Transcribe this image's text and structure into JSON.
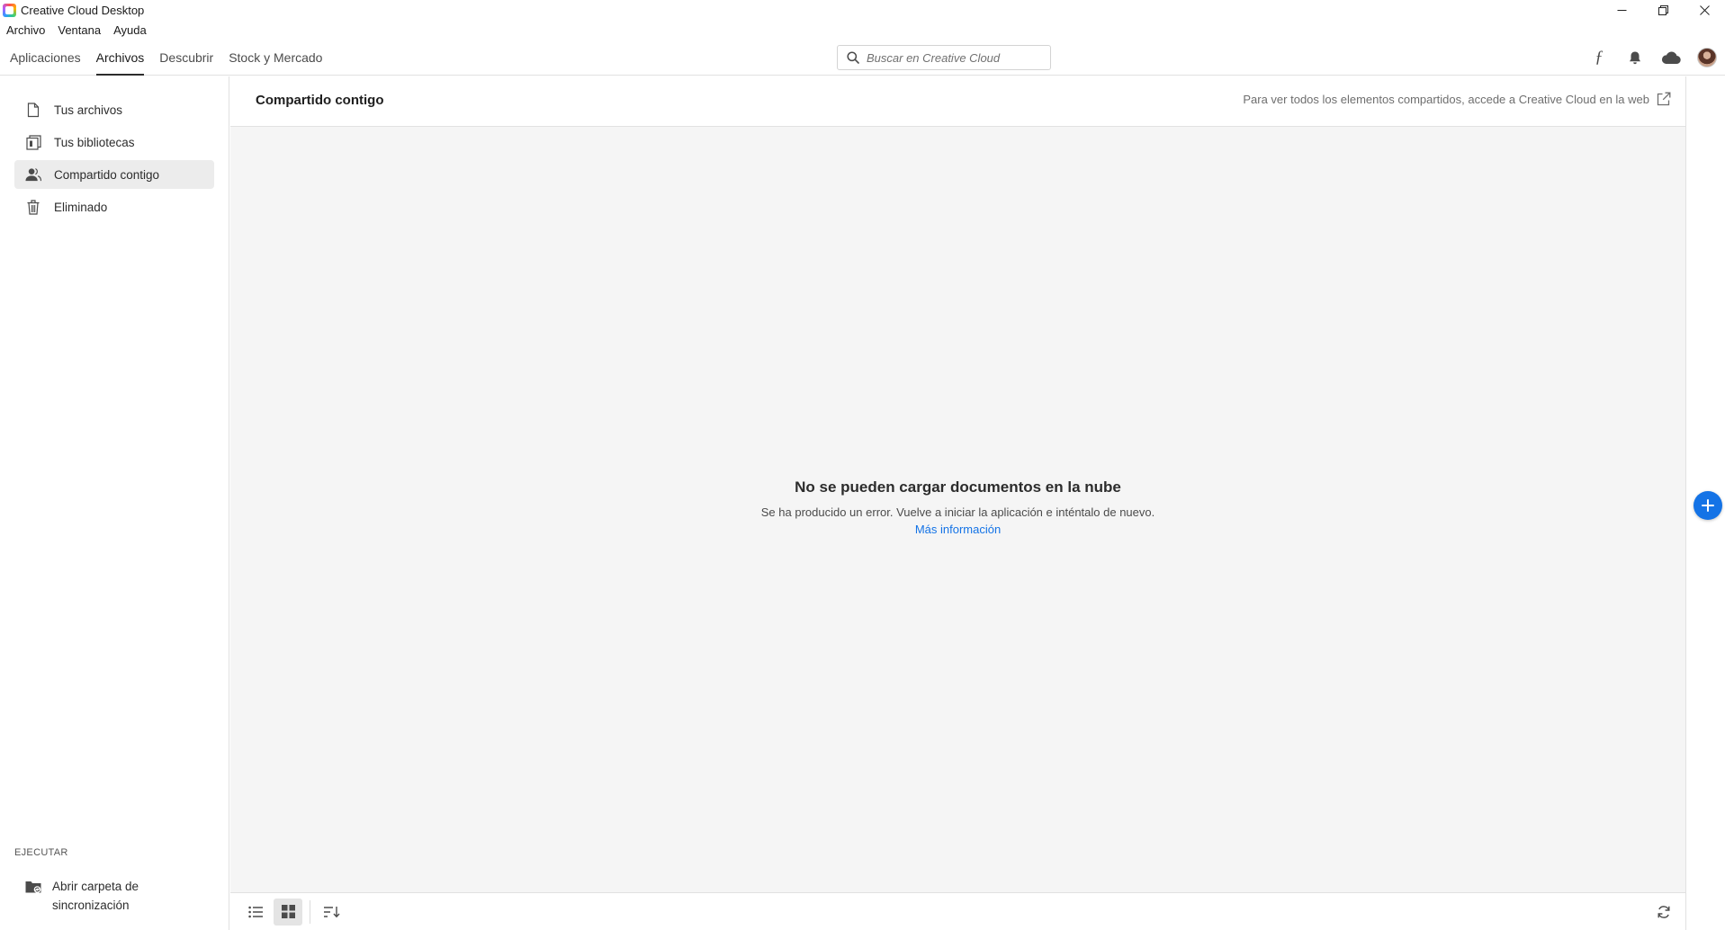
{
  "window": {
    "title": "Creative Cloud Desktop",
    "controls": [
      "minimize-icon",
      "restore-icon",
      "close-icon"
    ]
  },
  "menu": [
    "Archivo",
    "Ventana",
    "Ayuda"
  ],
  "nav": {
    "tabs": [
      {
        "label": "Aplicaciones",
        "active": false
      },
      {
        "label": "Archivos",
        "active": true
      },
      {
        "label": "Descubrir",
        "active": false
      },
      {
        "label": "Stock y Mercado",
        "active": false
      }
    ],
    "search_placeholder": "Buscar en Creative Cloud",
    "search_value": "",
    "icons": [
      "fonts-icon",
      "bell-icon",
      "cloud-icon",
      "avatar"
    ]
  },
  "sidebar": {
    "items": [
      {
        "label": "Tus archivos",
        "icon": "file-icon",
        "active": false
      },
      {
        "label": "Tus bibliotecas",
        "icon": "library-icon",
        "active": false
      },
      {
        "label": "Compartido contigo",
        "icon": "people-icon",
        "active": true
      },
      {
        "label": "Eliminado",
        "icon": "trash-icon",
        "active": false
      }
    ],
    "section_label": "EJECUTAR",
    "sync_label": "Abrir carpeta de sincronización"
  },
  "main": {
    "title": "Compartido contigo",
    "hint": "Para ver todos los elementos compartidos, accede a Creative Cloud en la web",
    "empty_title": "No se pueden cargar documentos en la nube",
    "empty_message": "Se ha producido un error. Vuelve a iniciar la aplicación e inténtalo de nuevo.",
    "empty_link": "Más información"
  },
  "footer": {
    "view_mode": "grid",
    "icons": [
      "list-view-icon",
      "grid-view-icon",
      "sort-icon",
      "refresh-icon"
    ]
  },
  "colors": {
    "accent": "#1473e6",
    "content_bg": "#f5f5f5",
    "active_item_bg": "#ececec"
  }
}
